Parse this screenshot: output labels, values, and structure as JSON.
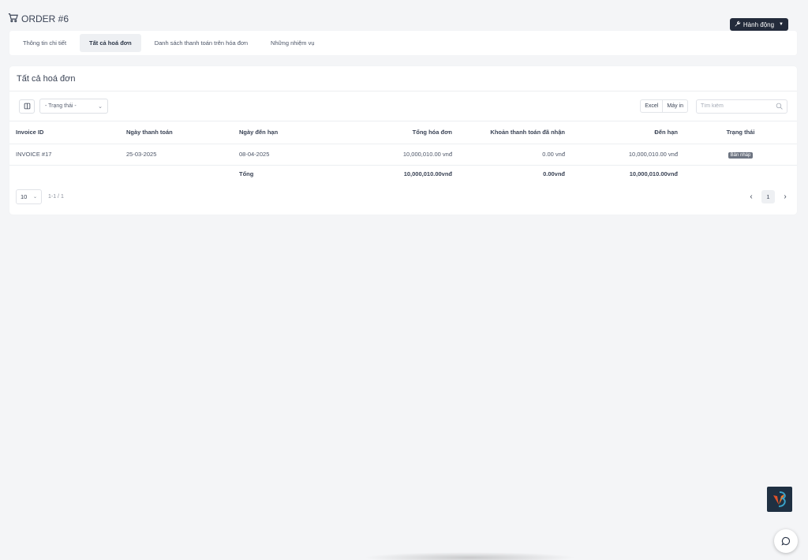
{
  "header": {
    "title": "ORDER #6",
    "cart_icon": "cart-icon",
    "action_label": "Hành động",
    "action_icon": "wrench-icon"
  },
  "tabs": [
    {
      "label": "Thông tin chi tiết",
      "active": false
    },
    {
      "label": "Tất cả hoá đơn",
      "active": true
    },
    {
      "label": "Danh sách thanh toán trên hóa đơn",
      "active": false
    },
    {
      "label": "Những nhiệm vụ",
      "active": false
    }
  ],
  "card": {
    "title": "Tất cả hoá đơn",
    "toolbar": {
      "columns_icon": "columns-icon",
      "status_select_value": "- Trạng thái -",
      "excel_label": "Excel",
      "print_label": "Máy in",
      "search_placeholder": "Tìm kiếm",
      "search_icon": "search-icon"
    },
    "table": {
      "headers": [
        "Invoice ID",
        "Ngày thanh toán",
        "Ngày đến hạn",
        "Tổng hóa đơn",
        "Khoản thanh toán đã nhận",
        "Đến hạn",
        "Trạng thái"
      ],
      "rows": [
        {
          "invoice_id": "INVOICE #17",
          "payment_date": "25-03-2025",
          "due_date": "08-04-2025",
          "total": "10,000,010.00 vnđ",
          "received": "0.00 vnđ",
          "due": "10,000,010.00 vnđ",
          "status": "Bản nháp"
        }
      ],
      "totals": {
        "label": "Tổng",
        "total": "10,000,010.00vnđ",
        "received": "0.00vnđ",
        "due": "10,000,010.00vnđ"
      }
    },
    "pagination": {
      "per_page": "10",
      "range": "1-1 / 1",
      "current_page": "1",
      "prev_icon": "chevron-left-icon",
      "next_icon": "chevron-right-icon"
    }
  },
  "widgets": {
    "logo_icon": "brand-logo-icon",
    "chat_icon": "chat-bubble-icon"
  },
  "colors": {
    "background": "#f4f5f7",
    "dark_button": "#232b3b",
    "badge": "#6e7582"
  }
}
